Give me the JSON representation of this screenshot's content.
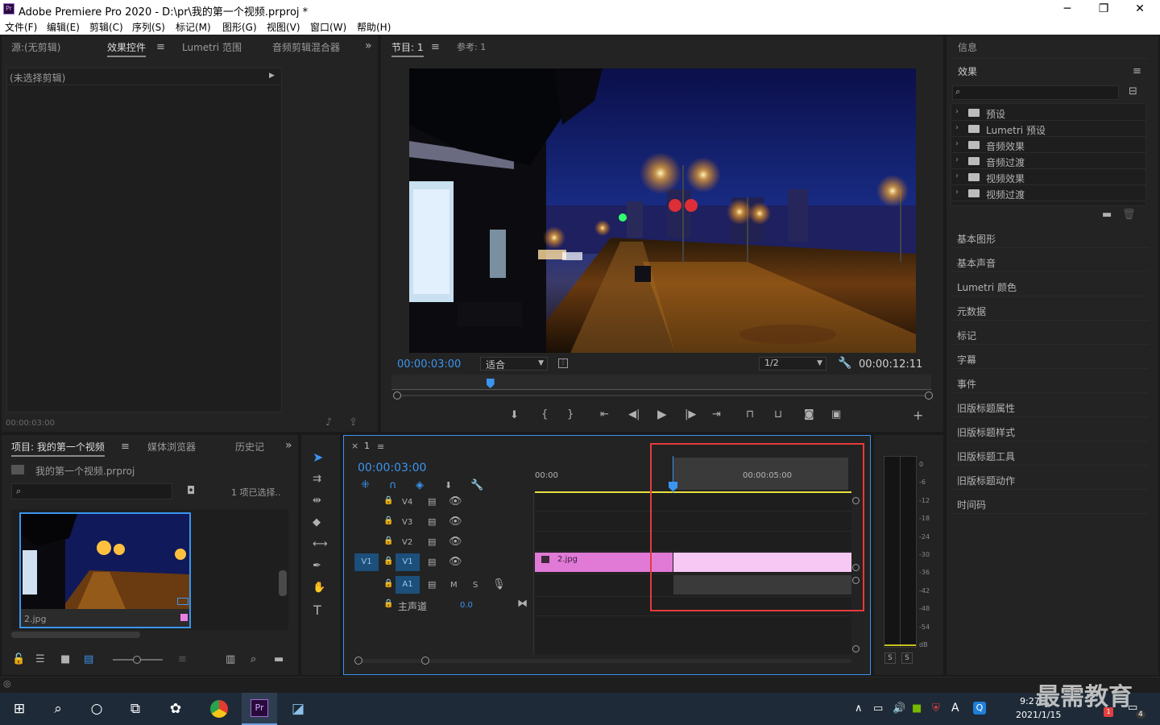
{
  "app": {
    "title": "Adobe Premiere Pro 2020 - D:\\pr\\我的第一个视频.prproj *",
    "logo": "Pr",
    "window_controls": {
      "minimize": "─",
      "maximize": "❐",
      "close": "✕"
    }
  },
  "menu": [
    "文件(F)",
    "编辑(E)",
    "剪辑(C)",
    "序列(S)",
    "标记(M)",
    "图形(G)",
    "视图(V)",
    "窗口(W)",
    "帮助(H)"
  ],
  "source_panel": {
    "tabs": [
      "源:(无剪辑)",
      "效果控件",
      "Lumetri 范围",
      "音频剪辑混合器"
    ],
    "active_tab": "效果控件",
    "menu_icon": "≡",
    "overflow_icon": "»",
    "no_clip_label": "(未选择剪辑)",
    "timecode": "00:00:03:00"
  },
  "program_monitor": {
    "tabs": [
      "节目: 1",
      "参考: 1"
    ],
    "menu_icon": "≡",
    "timecode_current": "00:00:03:00",
    "fit_value": "适合",
    "resolution_value": "1/2",
    "timecode_duration": "00:00:12:11",
    "playhead_fraction": 0.183
  },
  "project_panel": {
    "tabs": [
      "项目: 我的第一个视频",
      "媒体浏览器",
      "历史记"
    ],
    "menu_icon": "≡",
    "project_file": "我的第一个视频.prproj",
    "selection_status": "1 项已选择..",
    "search_placeholder": "",
    "clip_name": "2.jpg"
  },
  "timeline": {
    "close_icon": "×",
    "sequence_name": "1",
    "menu_icon": "≡",
    "timecode": "00:00:03:00",
    "ruler": [
      "00:00",
      "00:00:05:00"
    ],
    "tracks": {
      "v4": "V4",
      "v3": "V3",
      "v2": "V2",
      "v1_source": "V1",
      "v1": "V1",
      "a1": "A1",
      "mute": "M",
      "solo": "S"
    },
    "master": {
      "label": "主声道",
      "value": "0.0"
    },
    "clip_name": "2.jpg"
  },
  "audio_meter": {
    "scale": [
      "0",
      "-6",
      "-12",
      "-18",
      "-24",
      "-30",
      "-36",
      "-42",
      "-48",
      "-54",
      "dB"
    ],
    "solo_buttons": [
      "S",
      "S"
    ]
  },
  "right_panel": {
    "info_label": "信息",
    "effects_title": "效果",
    "menu_icon": "≡",
    "search_placeholder": "",
    "effect_folders": [
      "预设",
      "Lumetri 预设",
      "音频效果",
      "音频过渡",
      "视频效果",
      "视频过渡"
    ],
    "panels": [
      "基本图形",
      "基本声音",
      "Lumetri 颜色",
      "元数据",
      "标记",
      "字幕",
      "事件",
      "旧版标题属性",
      "旧版标题样式",
      "旧版标题工具",
      "旧版标题动作",
      "时间码"
    ]
  },
  "taskbar": {
    "time": "9:27",
    "date": "2021/1/15",
    "ime": "A",
    "notification_count": "4",
    "security_badge": "1",
    "watermark": "最需教育"
  },
  "colors": {
    "accent_blue": "#3b95f0",
    "clip_pink": "#e07ad6",
    "highlight_red": "#e53b3b",
    "yellow_line": "#e8e040"
  }
}
